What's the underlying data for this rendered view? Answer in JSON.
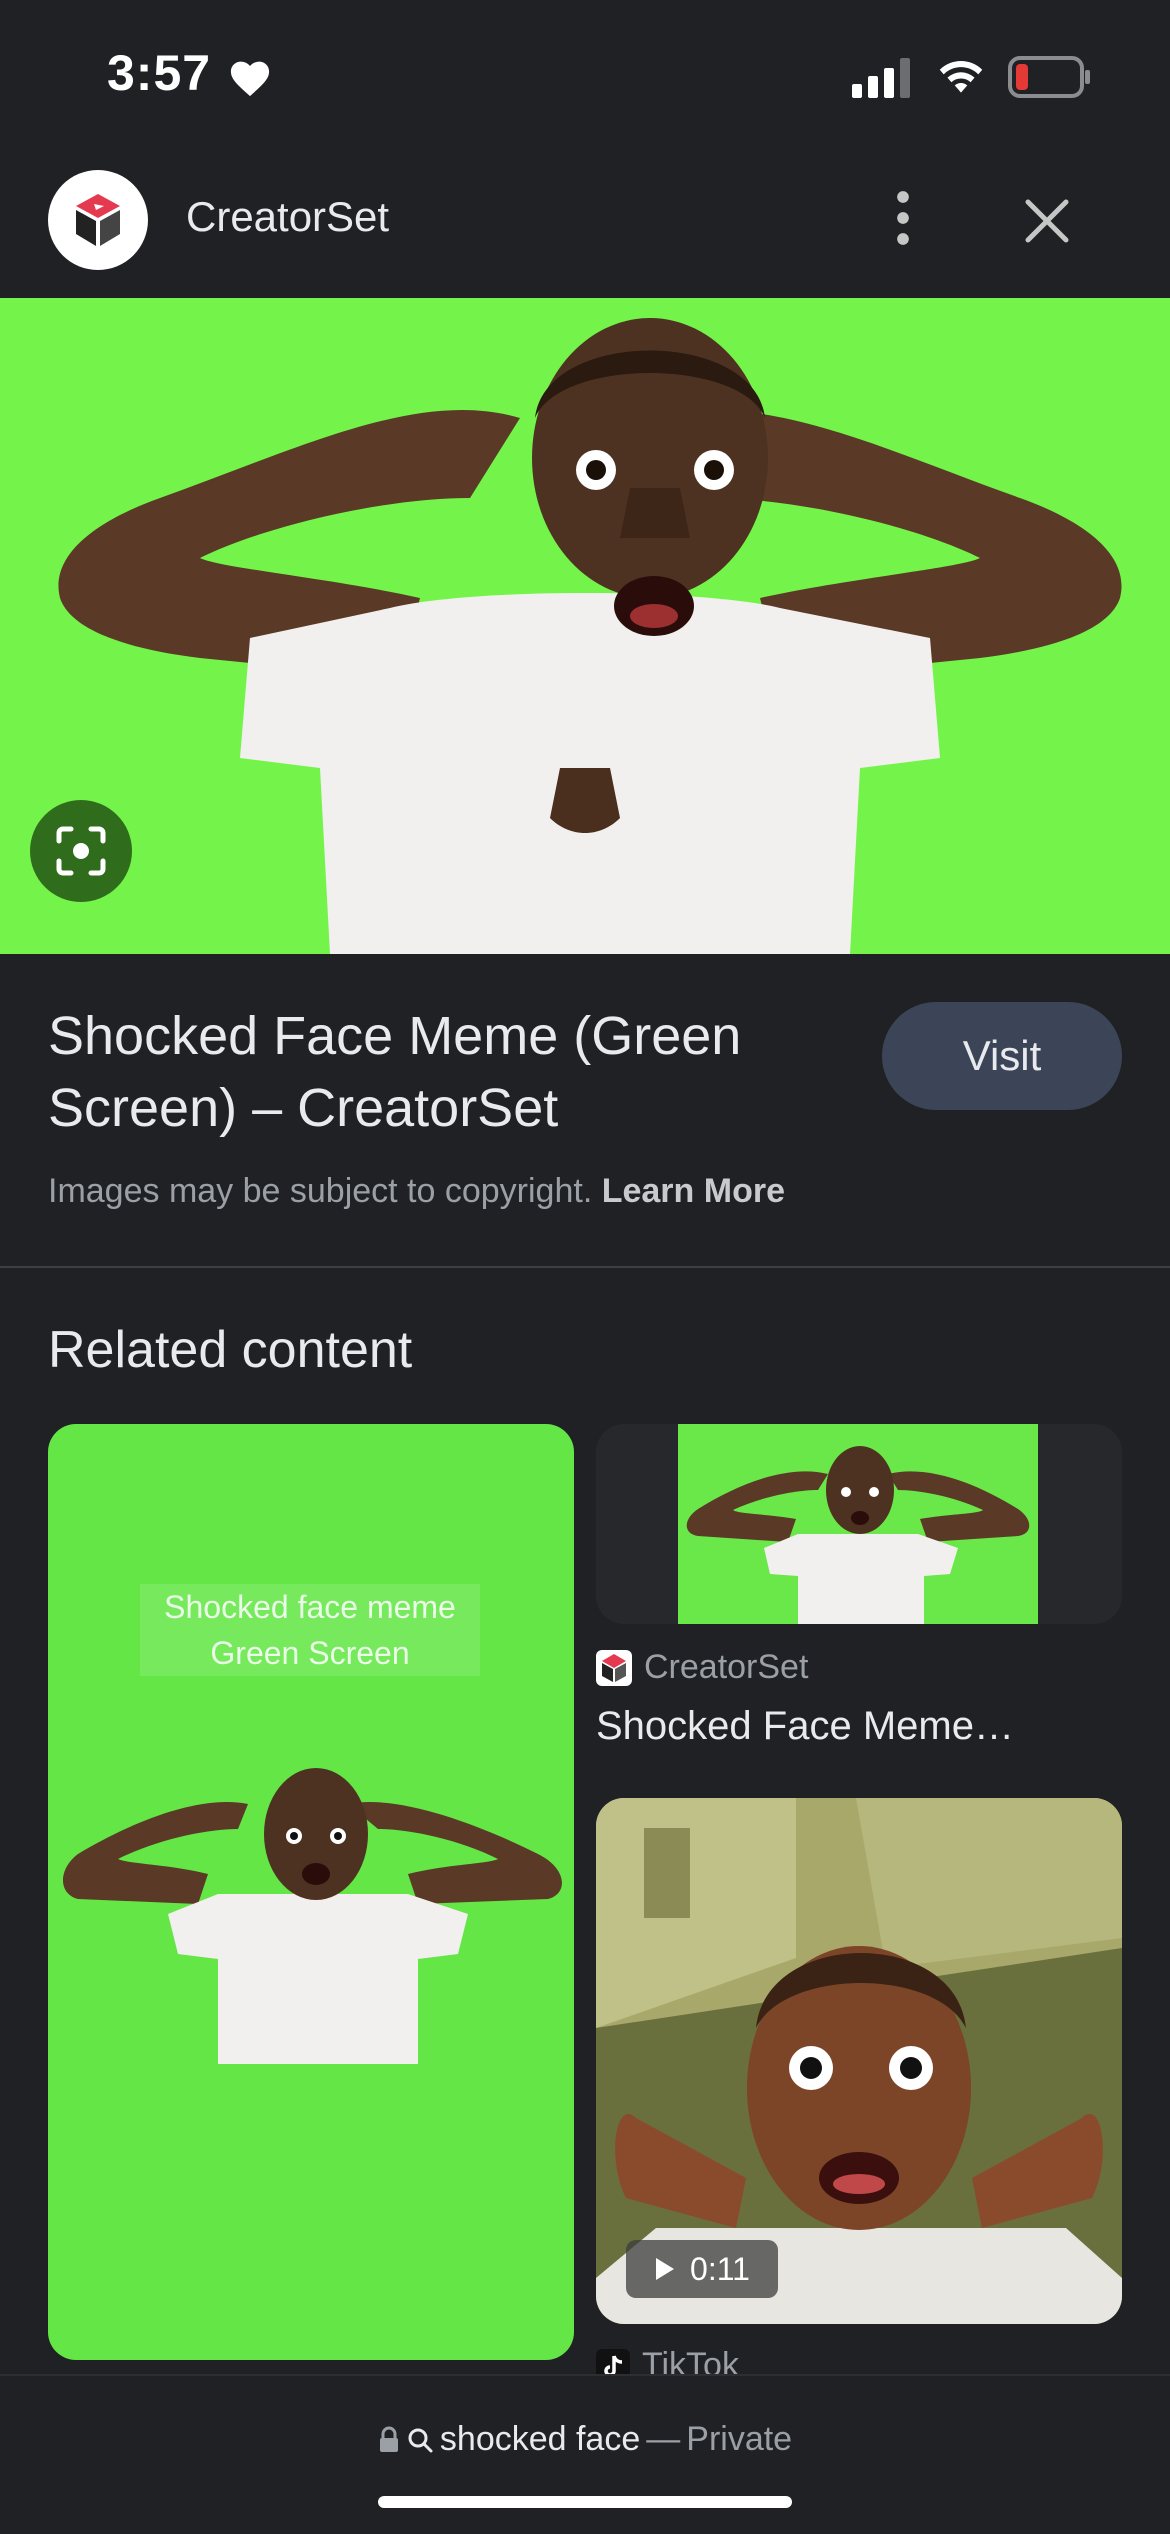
{
  "status_bar": {
    "time": "3:57"
  },
  "header": {
    "site_name": "CreatorSet",
    "more_icon": "more-vert-icon",
    "close_icon": "close-icon"
  },
  "result": {
    "title": "Shocked Face Meme (Green Screen) – CreatorSet",
    "visit_label": "Visit",
    "copyright_text": "Images may be subject to copyright.",
    "learn_more_label": "Learn More"
  },
  "related": {
    "heading": "Related content",
    "items": [
      {
        "caption_line1": "Shocked face meme",
        "caption_line2": "Green Screen"
      },
      {
        "source": "CreatorSet",
        "title": "Shocked Face Meme…"
      },
      {
        "duration": "0:11",
        "source": "TikTok"
      }
    ]
  },
  "bottom_bar": {
    "query": "shocked face",
    "separator": "—",
    "mode": "Private"
  },
  "colors": {
    "background": "#202124",
    "green_screen": "#74f44a",
    "visit_button": "#3c4457",
    "battery_low": "#e53935"
  }
}
